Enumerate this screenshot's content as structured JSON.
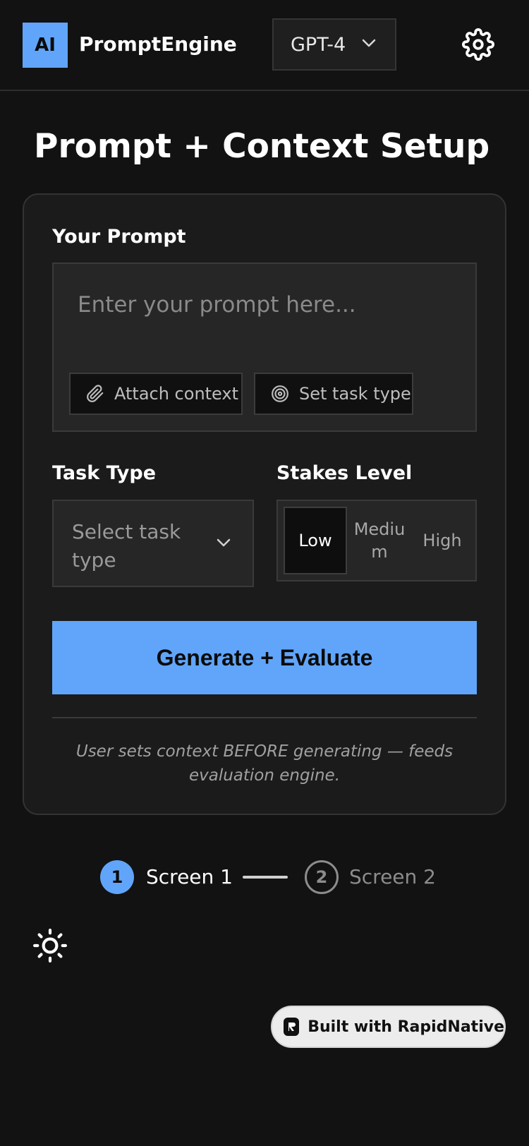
{
  "header": {
    "logo_text": "AI",
    "app_name": "PromptEngine",
    "model": "GPT-4",
    "settings_icon": "gear-icon"
  },
  "page": {
    "title": "Prompt + Context Setup"
  },
  "form": {
    "prompt_label": "Your Prompt",
    "prompt_placeholder": "Enter your prompt here...",
    "prompt_value": "",
    "attach_context_label": "Attach context",
    "set_task_type_label": "Set task type",
    "task_type_label": "Task Type",
    "task_type_value": "Select task type",
    "stakes_label": "Stakes Level",
    "stakes_options": [
      "Low",
      "Medium",
      "High"
    ],
    "stakes_selected": "Low",
    "generate_label": "Generate + Evaluate",
    "note": "User sets context BEFORE generating — feeds evaluation engine."
  },
  "steps": [
    {
      "number": "1",
      "label": "Screen 1",
      "active": true
    },
    {
      "number": "2",
      "label": "Screen 2",
      "active": false
    }
  ],
  "theme_toggle_icon": "sun-icon",
  "badge": {
    "label": "Built with RapidNative"
  },
  "colors": {
    "accent": "#60a5fa",
    "background": "#121212",
    "card": "#1b1b1b"
  }
}
